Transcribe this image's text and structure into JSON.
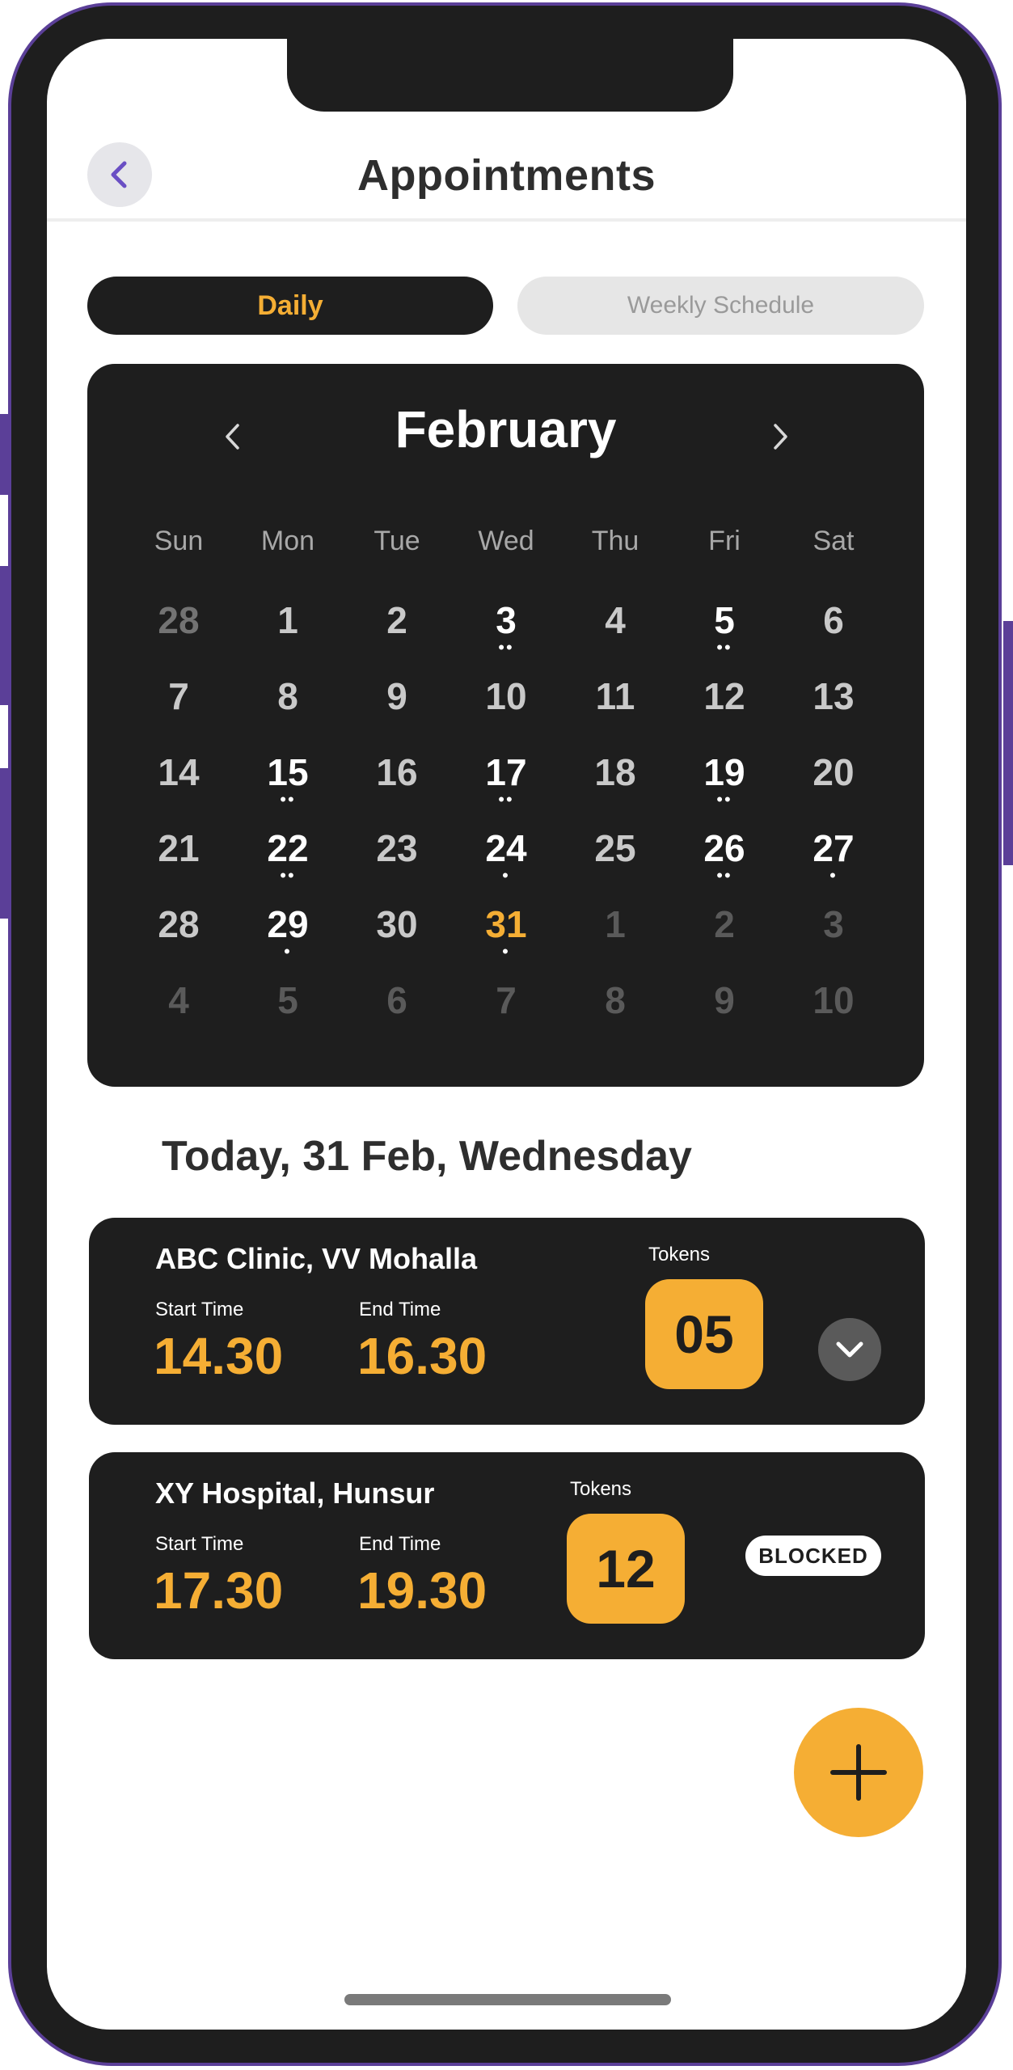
{
  "header": {
    "title": "Appointments",
    "back_icon": "chevron-left-icon"
  },
  "tabs": [
    {
      "label": "Daily",
      "active": true
    },
    {
      "label": "Weekly Schedule",
      "active": false
    }
  ],
  "calendar": {
    "month": "February",
    "weekdays": [
      "Sun",
      "Mon",
      "Tue",
      "Wed",
      "Thu",
      "Fri",
      "Sat"
    ],
    "weeks": [
      [
        {
          "d": "28",
          "kind": "prev"
        },
        {
          "d": "1",
          "kind": "norm"
        },
        {
          "d": "2",
          "kind": "norm"
        },
        {
          "d": "3",
          "kind": "evt",
          "dots": 2
        },
        {
          "d": "4",
          "kind": "norm"
        },
        {
          "d": "5",
          "kind": "evt",
          "dots": 2
        },
        {
          "d": "6",
          "kind": "norm"
        }
      ],
      [
        {
          "d": "7",
          "kind": "norm"
        },
        {
          "d": "8",
          "kind": "norm"
        },
        {
          "d": "9",
          "kind": "norm"
        },
        {
          "d": "10",
          "kind": "norm"
        },
        {
          "d": "11",
          "kind": "norm"
        },
        {
          "d": "12",
          "kind": "norm"
        },
        {
          "d": "13",
          "kind": "norm"
        }
      ],
      [
        {
          "d": "14",
          "kind": "norm"
        },
        {
          "d": "15",
          "kind": "evt",
          "dots": 2
        },
        {
          "d": "16",
          "kind": "norm"
        },
        {
          "d": "17",
          "kind": "evt",
          "dots": 2
        },
        {
          "d": "18",
          "kind": "norm"
        },
        {
          "d": "19",
          "kind": "evt",
          "dots": 2
        },
        {
          "d": "20",
          "kind": "norm"
        }
      ],
      [
        {
          "d": "21",
          "kind": "norm"
        },
        {
          "d": "22",
          "kind": "evt",
          "dots": 2
        },
        {
          "d": "23",
          "kind": "norm"
        },
        {
          "d": "24",
          "kind": "evt",
          "dots": 1
        },
        {
          "d": "25",
          "kind": "norm"
        },
        {
          "d": "26",
          "kind": "evt",
          "dots": 2
        },
        {
          "d": "27",
          "kind": "evt",
          "dots": 1
        }
      ],
      [
        {
          "d": "28",
          "kind": "norm"
        },
        {
          "d": "29",
          "kind": "evt",
          "dots": 1
        },
        {
          "d": "30",
          "kind": "norm"
        },
        {
          "d": "31",
          "kind": "today",
          "dots": 1
        },
        {
          "d": "1",
          "kind": "next"
        },
        {
          "d": "2",
          "kind": "next"
        },
        {
          "d": "3",
          "kind": "next"
        }
      ],
      [
        {
          "d": "4",
          "kind": "next"
        },
        {
          "d": "5",
          "kind": "next"
        },
        {
          "d": "6",
          "kind": "next"
        },
        {
          "d": "7",
          "kind": "next"
        },
        {
          "d": "8",
          "kind": "next"
        },
        {
          "d": "9",
          "kind": "next"
        },
        {
          "d": "10",
          "kind": "next"
        }
      ]
    ]
  },
  "date_heading": "Today, 31 Feb, Wednesday",
  "appointments": [
    {
      "clinic": "ABC Clinic, VV Mohalla",
      "start_label": "Start Time",
      "start": "14.30",
      "end_label": "End Time",
      "end": "16.30",
      "tokens_label": "Tokens",
      "tokens": "05",
      "action_icon": "chevron-down-icon"
    },
    {
      "clinic": "XY Hospital, Hunsur",
      "start_label": "Start Time",
      "start": "17.30",
      "end_label": "End Time",
      "end": "19.30",
      "tokens_label": "Tokens",
      "tokens": "12",
      "status": "BLOCKED"
    }
  ],
  "fab_icon": "plus-icon",
  "colors": {
    "accent": "#f5ae34",
    "dark": "#1e1e1e",
    "frame": "#5b3f98",
    "back_arrow": "#6a4fc4"
  }
}
